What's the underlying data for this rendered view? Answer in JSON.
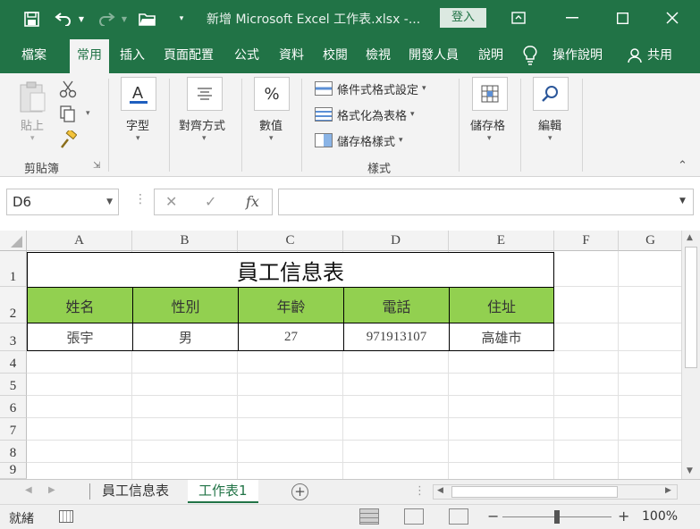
{
  "titlebar": {
    "title": "新增 Microsoft Excel 工作表.xlsx  -...",
    "login": "登入",
    "icons": [
      "save-icon",
      "undo-icon",
      "redo-icon",
      "open-folder-icon",
      "customize-icon",
      "ribbon-display-icon",
      "minimize-icon",
      "maximize-icon",
      "close-icon"
    ]
  },
  "tabs": [
    {
      "label": "檔案"
    },
    {
      "label": "常用",
      "active": true
    },
    {
      "label": "插入"
    },
    {
      "label": "頁面配置"
    },
    {
      "label": "公式"
    },
    {
      "label": "資料"
    },
    {
      "label": "校閱"
    },
    {
      "label": "檢視"
    },
    {
      "label": "開發人員"
    },
    {
      "label": "說明"
    },
    {
      "label": "操作說明"
    },
    {
      "label": "共用"
    }
  ],
  "ribbon": {
    "clipboard": {
      "paste": "貼上",
      "group": "剪貼簿"
    },
    "font": {
      "label": "字型"
    },
    "alignment": {
      "label": "對齊方式"
    },
    "number": {
      "label": "數值"
    },
    "styles": {
      "conditional": "條件式格式設定",
      "as_table": "格式化為表格",
      "cell_styles": "儲存格樣式",
      "group": "樣式"
    },
    "cells": {
      "label": "儲存格"
    },
    "editing": {
      "label": "編輯"
    }
  },
  "formula_bar": {
    "namebox": "D6",
    "fx": "fx",
    "value": ""
  },
  "grid": {
    "columns": [
      "A",
      "B",
      "C",
      "D",
      "E",
      "F",
      "G"
    ],
    "rows": [
      "1",
      "2",
      "3",
      "4",
      "5",
      "6",
      "7",
      "8",
      "9"
    ],
    "title": "員工信息表",
    "headers": [
      "姓名",
      "性別",
      "年齡",
      "電話",
      "住址"
    ],
    "data_row": [
      "張宇",
      "男",
      "27",
      "971913107",
      "高雄市"
    ]
  },
  "sheets": {
    "tabs": [
      "員工信息表",
      "工作表1"
    ],
    "active_index": 1
  },
  "status": {
    "ready": "就緒",
    "zoom": "100%",
    "zoom_level": 1.0
  },
  "colors": {
    "brand": "#217346",
    "header_fill": "#92d050"
  }
}
